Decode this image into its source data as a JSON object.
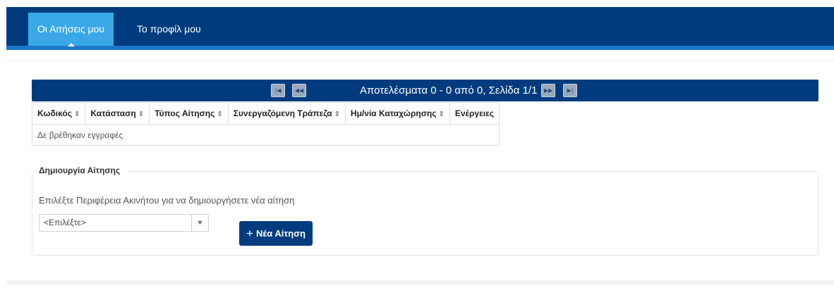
{
  "nav": {
    "tabs": [
      {
        "label": "Οι Αιτήσεις μου",
        "active": true
      },
      {
        "label": "Το προφίλ μου",
        "active": false
      }
    ]
  },
  "pager": {
    "first": "|◀",
    "prev": "◀◀",
    "next": "▶▶",
    "last": "▶|",
    "text": "Αποτελέσματα 0 - 0 από 0, Σελίδα 1/1"
  },
  "table": {
    "columns": [
      "Κωδικός",
      "Κατάσταση",
      "Τύπος Αίτησης",
      "Συνεργαζόμενη Τράπεζα",
      "Ημ/νία Καταχώρησης",
      "Ενέργειες"
    ],
    "sort_icon": "⇕",
    "empty": "Δε βρέθηκαν εγγραφές"
  },
  "create": {
    "legend": "Δημιουργία Αίτησης",
    "instruction": "Επιλέξτε Περιφέρεια Ακινήτου για να δημιουργήσετε νέα αίτηση",
    "select_value": "<Επιλέξτε>",
    "button_plus": "+",
    "button_label": "Νέα Αίτηση"
  },
  "colors": {
    "navy": "#003c7d",
    "active_tab": "#3aa8e6",
    "accent": "#1e78c8"
  }
}
